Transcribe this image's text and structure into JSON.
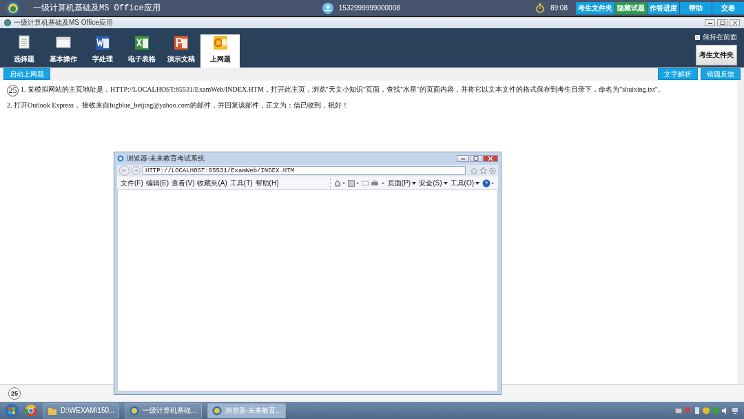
{
  "top_bar": {
    "title": "一级计算机基础及MS Office应用",
    "user_id": "1532999999000008",
    "timer": "89:08",
    "buttons": [
      {
        "label": "考生文件夹",
        "color": "#14a0e0"
      },
      {
        "label": "隐藏试题",
        "color": "#2e9a4e"
      },
      {
        "label": "作答进度",
        "color": "#14a0e0"
      },
      {
        "label": "帮助",
        "color": "#14a0e0"
      },
      {
        "label": "交卷",
        "color": "#14a0e0"
      }
    ]
  },
  "window": {
    "title": "一级计算机基础及MS Office应用"
  },
  "tabs": [
    {
      "label": "选择题",
      "selected": false
    },
    {
      "label": "基本操作",
      "selected": false
    },
    {
      "label": "字处理",
      "selected": false
    },
    {
      "label": "电子表格",
      "selected": false
    },
    {
      "label": "演示文稿",
      "selected": false
    },
    {
      "label": "上网题",
      "selected": true
    }
  ],
  "keep_on_top": {
    "label": "保持在前面",
    "checked": false
  },
  "side_button": "考生文件夹",
  "action_bar": {
    "left_button": "启动上网题",
    "right_buttons": [
      "文字解析",
      "错题反馈"
    ]
  },
  "question": {
    "number": "25",
    "items": [
      "1. 某模拟网站的主页地址是，HTTP://LOCALHOST:65531/ExamWeb/INDEX.HTM，打开此主页，浏览\"天文小知识\"页面，查找\"水星\"的页面内容，并将它以文本文件的格式保存到考生目录下，命名为\"shuixing.txt\"。",
      "2. 打开Outlook Express， 接收来自bigblue_beijing@yahoo.com的邮件，并回复该邮件，正文为：信已收到，祝好！"
    ]
  },
  "footer": {
    "number": "25"
  },
  "browser": {
    "title": "浏览器-未来教育考试系统",
    "address": "HTTP://LOCALHOST:65531/ExamWeb/INDEX.HTM",
    "menu": [
      "文件(F)",
      "编辑(E)",
      "查看(V)",
      "收藏夹(A)",
      "工具(T)",
      "帮助(H)"
    ],
    "commands": [
      "页面(P)",
      "安全(S)",
      "工具(O)"
    ]
  },
  "taskbar": {
    "items": [
      {
        "label": "D:\\WEXAM\\150...",
        "selected": false
      },
      {
        "label": "一级计算机基础...",
        "selected": false
      },
      {
        "label": "浏览器-未来教育...",
        "selected": true
      }
    ]
  }
}
